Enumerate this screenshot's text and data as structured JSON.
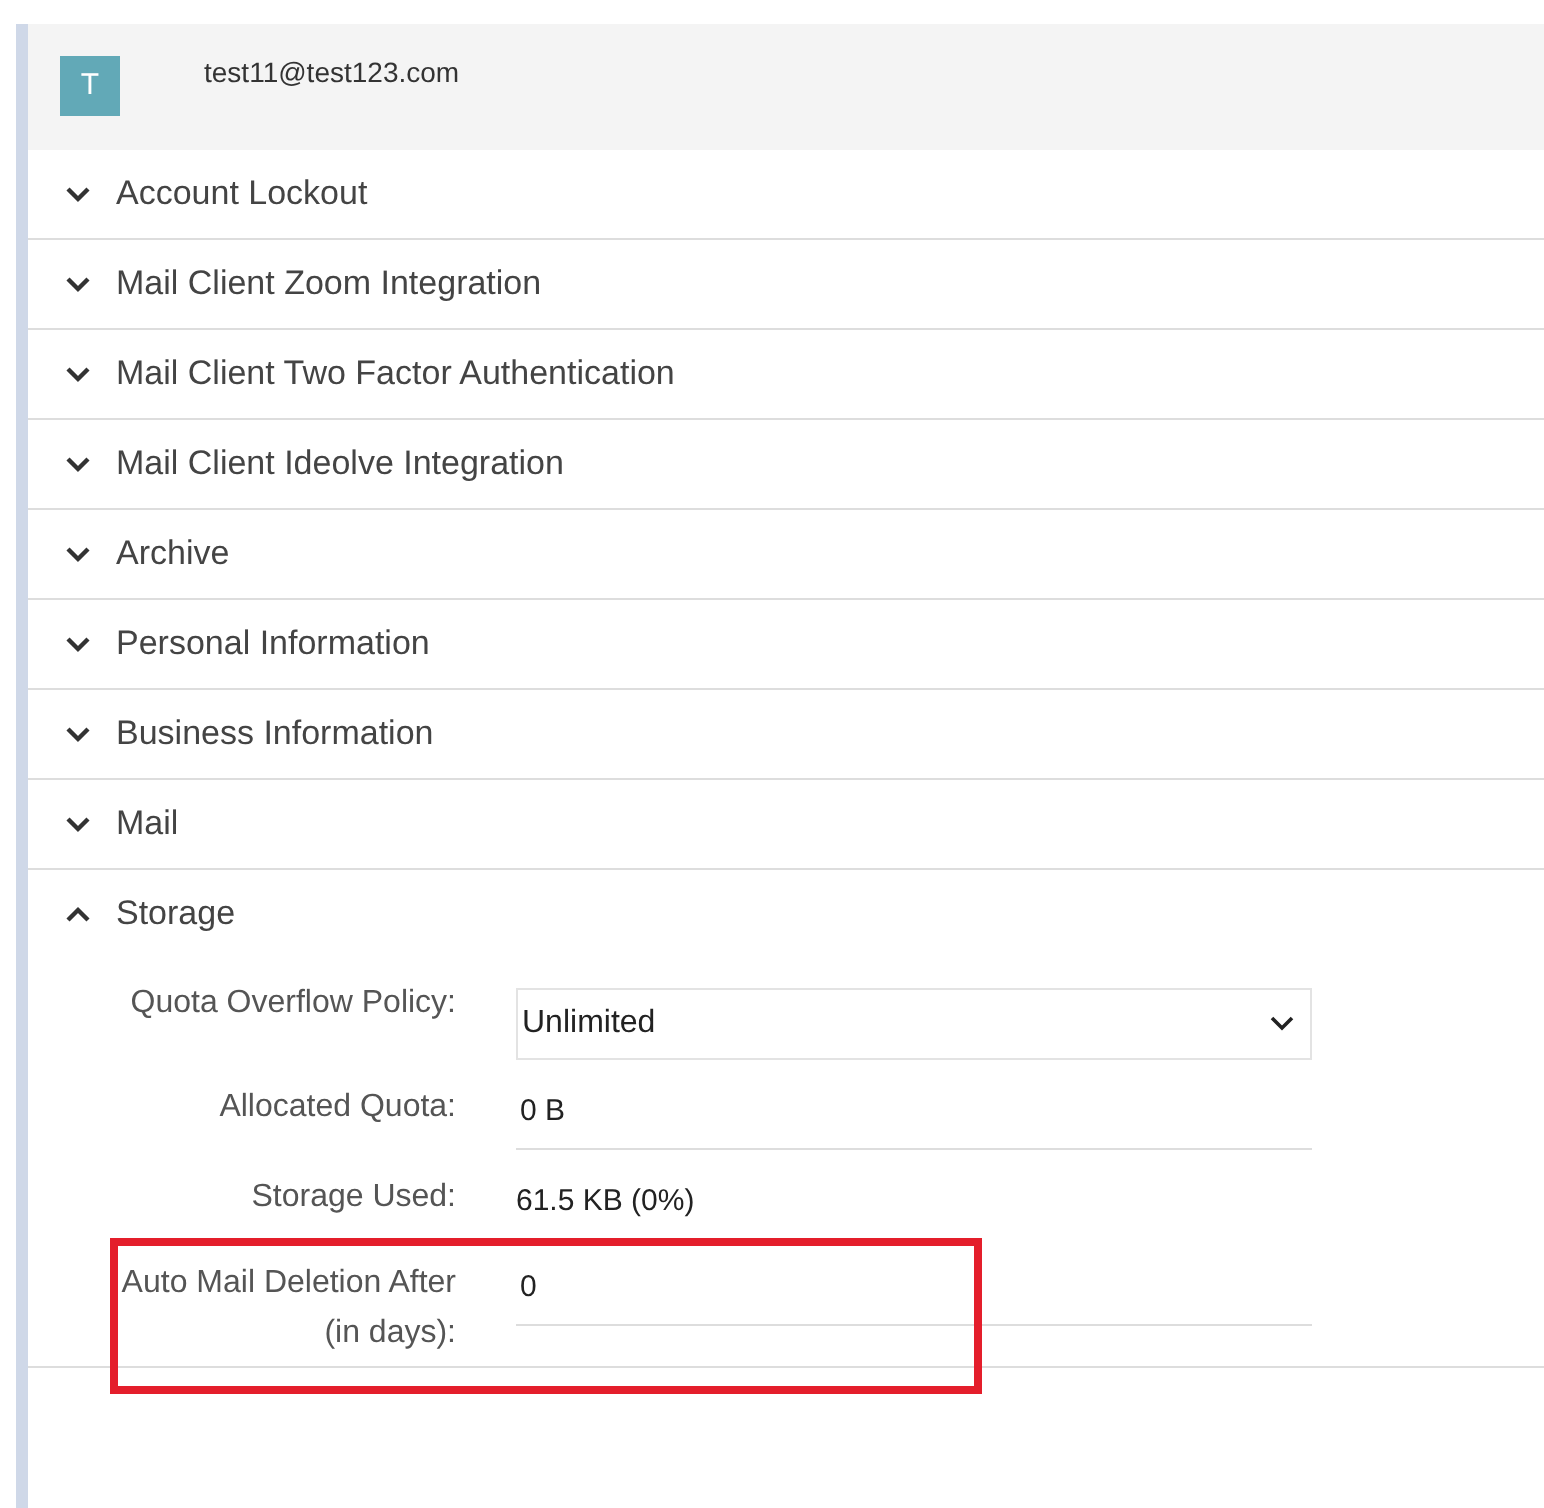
{
  "account": {
    "avatar": "T",
    "email": "test11@test123.com"
  },
  "sections": [
    {
      "title": "Account Lockout",
      "expanded": false
    },
    {
      "title": "Mail Client Zoom Integration",
      "expanded": false
    },
    {
      "title": "Mail Client Two Factor Authentication",
      "expanded": false
    },
    {
      "title": "Mail Client Ideolve Integration",
      "expanded": false
    },
    {
      "title": "Archive",
      "expanded": false
    },
    {
      "title": "Personal Information",
      "expanded": false
    },
    {
      "title": "Business Information",
      "expanded": false
    },
    {
      "title": "Mail",
      "expanded": false
    },
    {
      "title": "Storage",
      "expanded": true,
      "fields": [
        {
          "kind": "select",
          "label": "Quota Overflow Policy:",
          "value": "Unlimited",
          "highlighted": false
        },
        {
          "kind": "input",
          "label": "Allocated Quota:",
          "value": "0 B",
          "highlighted": false
        },
        {
          "kind": "static",
          "label": "Storage Used:",
          "value": "61.5 KB (0%)",
          "highlighted": false
        },
        {
          "kind": "input",
          "label": "Auto Mail Deletion After (in days):",
          "value": "0",
          "highlighted": true
        }
      ]
    }
  ]
}
